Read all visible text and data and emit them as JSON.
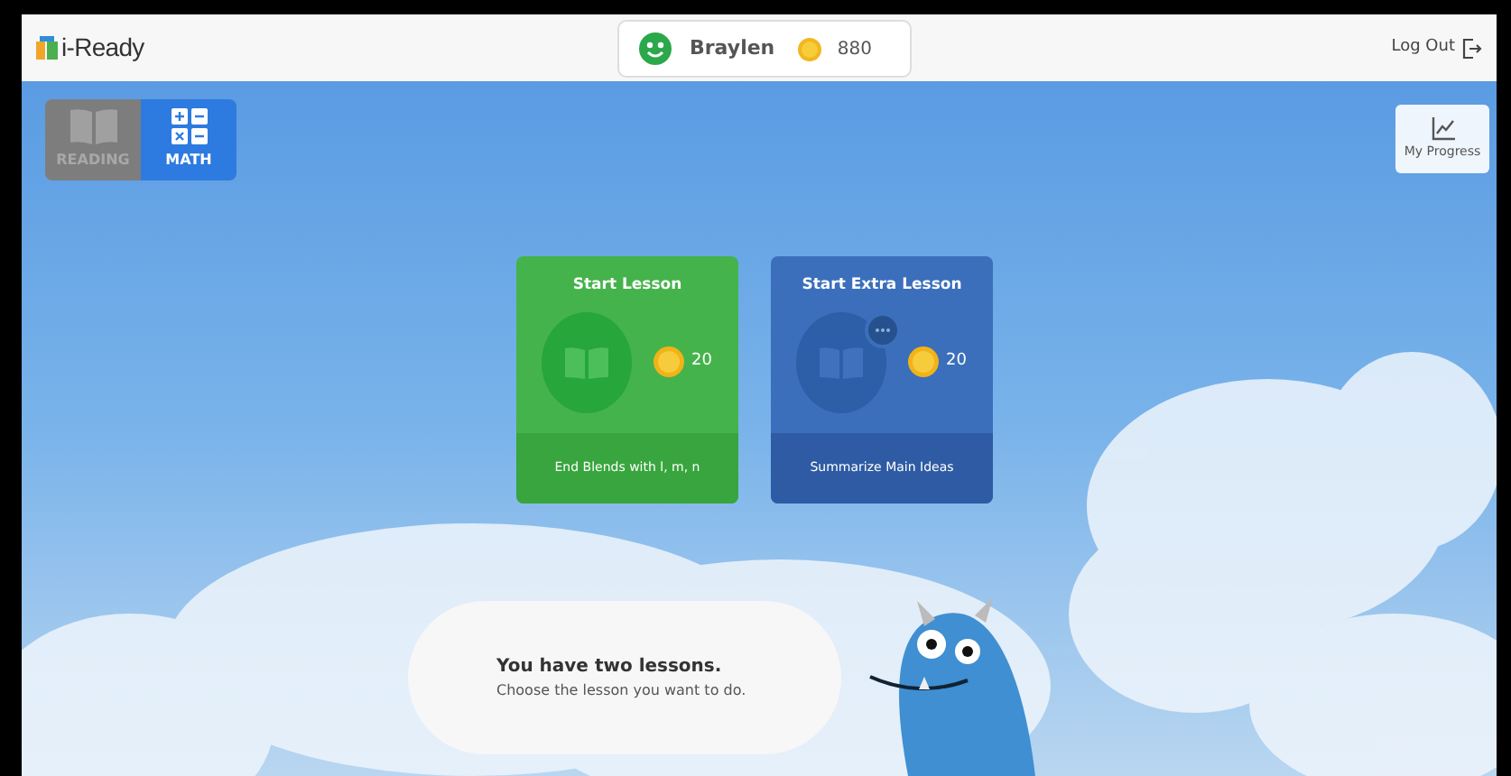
{
  "header": {
    "logo": "i-Ready",
    "user": {
      "name": "Braylen",
      "coins": "880"
    },
    "logout": "Log Out"
  },
  "subjects": [
    {
      "label": "READING",
      "selected": false
    },
    {
      "label": "MATH",
      "selected": true
    }
  ],
  "progress_button": "My Progress",
  "lessons": [
    {
      "kind": "main",
      "title": "Start Lesson",
      "coins": "20",
      "name": "End Blends with l, m, n"
    },
    {
      "kind": "extra",
      "title": "Start Extra Lesson",
      "coins": "20",
      "name": "Summarize Main Ideas"
    }
  ],
  "message": {
    "title": "You have two lessons.",
    "body": "Choose the lesson you want to do."
  }
}
